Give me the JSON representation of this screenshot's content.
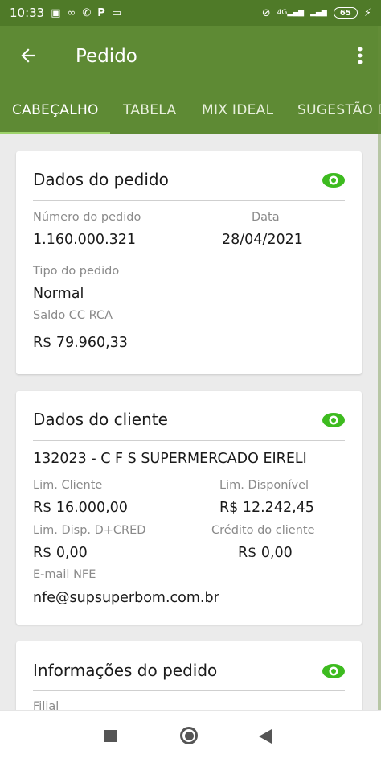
{
  "statusbar": {
    "time": "10:33",
    "battery": "65",
    "signal_label": "4G"
  },
  "appbar": {
    "title": "Pedido"
  },
  "tabs": [
    {
      "label": "CABEÇALHO"
    },
    {
      "label": "TABELA"
    },
    {
      "label": "MIX IDEAL"
    },
    {
      "label": "SUGESTÃO D"
    }
  ],
  "order_card": {
    "title": "Dados do pedido",
    "order_number_label": "Número do pedido",
    "order_number": "1.160.000.321",
    "date_label": "Data",
    "date": "28/04/2021",
    "type_label": "Tipo do pedido",
    "type": "Normal",
    "balance_label": "Saldo CC RCA",
    "balance": "R$ 79.960,33"
  },
  "client_card": {
    "title": "Dados do cliente",
    "client": "132023 - C F S SUPERMERCADO EIRELI",
    "limit_label": "Lim. Cliente",
    "limit": "R$ 16.000,00",
    "available_label": "Lim. Disponível",
    "available": "R$ 12.242,45",
    "disp_dcred_label": "Lim. Disp. D+CRED",
    "disp_dcred": "R$ 0,00",
    "credit_label": "Crédito do cliente",
    "credit": "R$ 0,00",
    "email_label": "E-mail NFE",
    "email": "nfe@supsuperbom.com.br"
  },
  "info_card": {
    "title": "Informações do pedido",
    "filial_label": "Filial"
  },
  "colors": {
    "statusbar": "#4f7a28",
    "appbar": "#5e8a34",
    "eye_icon": "#3dbb1f",
    "tab_indicator": "#9ed36b"
  }
}
